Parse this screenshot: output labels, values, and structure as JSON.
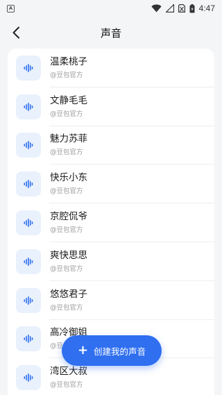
{
  "status_bar": {
    "app_glyph": "A",
    "time": "4:47",
    "icons": [
      "wifi-icon",
      "signal-icon",
      "sim-icon",
      "battery-icon"
    ]
  },
  "header": {
    "back_icon": "chevron-left-icon",
    "title": "声音"
  },
  "voices": [
    {
      "name": "温柔桃子",
      "source": "@豆包官方"
    },
    {
      "name": "文静毛毛",
      "source": "@豆包官方"
    },
    {
      "name": "魅力苏菲",
      "source": "@豆包官方"
    },
    {
      "name": "快乐小东",
      "source": "@豆包官方"
    },
    {
      "name": "京腔侃爷",
      "source": "@豆包官方"
    },
    {
      "name": "爽快思思",
      "source": "@豆包官方"
    },
    {
      "name": "悠悠君子",
      "source": "@豆包官方"
    },
    {
      "name": "高冷御姐",
      "source": "@豆包官方"
    },
    {
      "name": "湾区大叔",
      "source": "@豆包官方"
    }
  ],
  "fab": {
    "label": "创建我的声音",
    "icon": "plus-icon"
  },
  "colors": {
    "accent": "#2f6ff0",
    "icon_bg": "#e9f1fd",
    "background": "#f4f5f7"
  }
}
